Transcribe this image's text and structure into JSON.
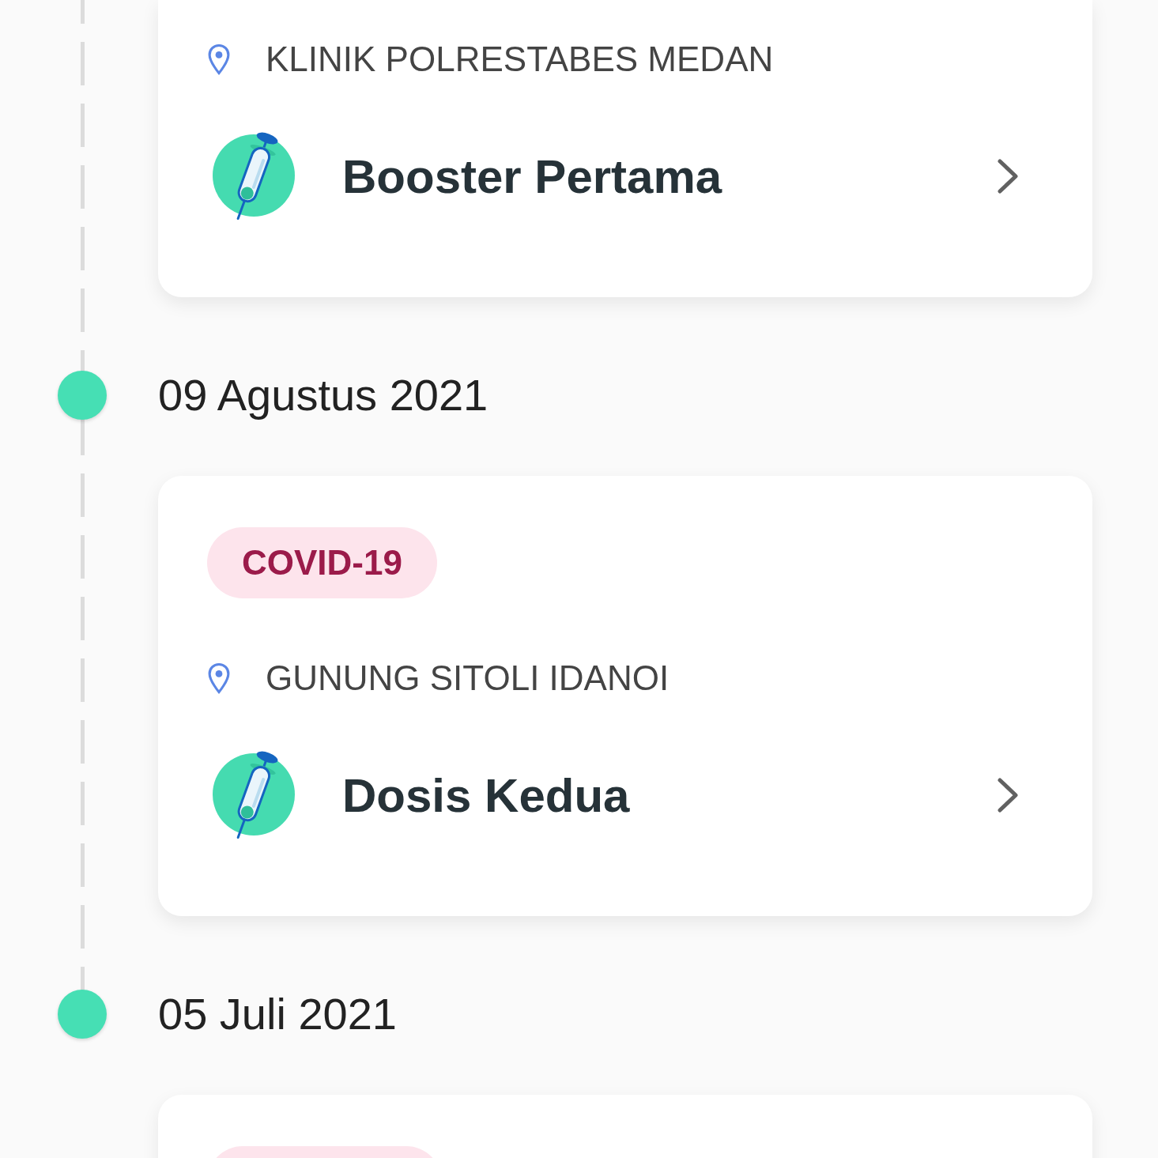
{
  "timeline": [
    {
      "card": {
        "location": "KLINIK POLRESTABES MEDAN",
        "title": "Booster Pertama"
      }
    },
    {
      "date": "09 Agustus 2021",
      "card": {
        "tag": "COVID-19",
        "location": "GUNUNG SITOLI IDANOI",
        "title": "Dosis Kedua"
      }
    },
    {
      "date": "05 Juli 2021",
      "card": {
        "tag_partial": true
      }
    }
  ]
}
